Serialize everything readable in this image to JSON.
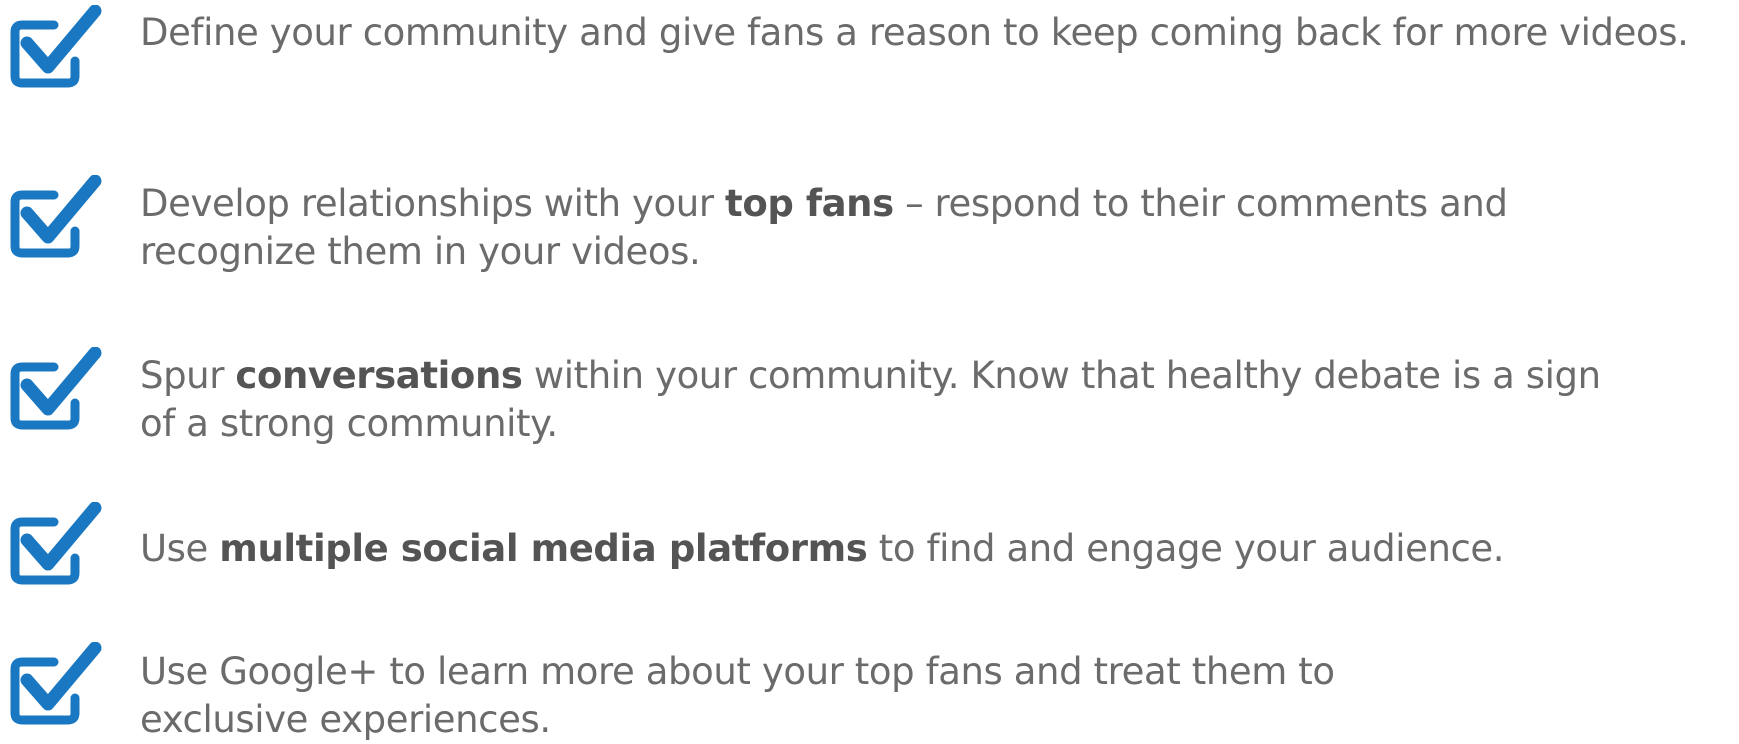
{
  "accent_color": "#1a78c2",
  "text_color": "#6b6b6b",
  "icon": "checkbox-checked-icon",
  "items": [
    {
      "lines": [
        [
          {
            "text": "Define your community and give fans a reason to keep coming back for more videos.",
            "bold": false
          }
        ]
      ]
    },
    {
      "lines": [
        [
          {
            "text": "Develop relationships with your ",
            "bold": false
          },
          {
            "text": "top fans",
            "bold": true
          },
          {
            "text": " – respond to their comments and",
            "bold": false
          }
        ],
        [
          {
            "text": "recognize them in your videos.",
            "bold": false
          }
        ]
      ]
    },
    {
      "lines": [
        [
          {
            "text": "Spur ",
            "bold": false
          },
          {
            "text": "conversations",
            "bold": true
          },
          {
            "text": " within your community. Know that healthy debate is a sign",
            "bold": false
          }
        ],
        [
          {
            "text": "of a strong community.",
            "bold": false
          }
        ]
      ]
    },
    {
      "lines": [
        [
          {
            "text": "Use ",
            "bold": false
          },
          {
            "text": "multiple social media platforms",
            "bold": true
          },
          {
            "text": " to find and engage your audience.",
            "bold": false
          }
        ]
      ]
    },
    {
      "lines": [
        [
          {
            "text": "Use Google+ to learn more about your top fans and treat them to",
            "bold": false
          }
        ],
        [
          {
            "text": "exclusive experiences.",
            "bold": false
          }
        ]
      ]
    }
  ]
}
